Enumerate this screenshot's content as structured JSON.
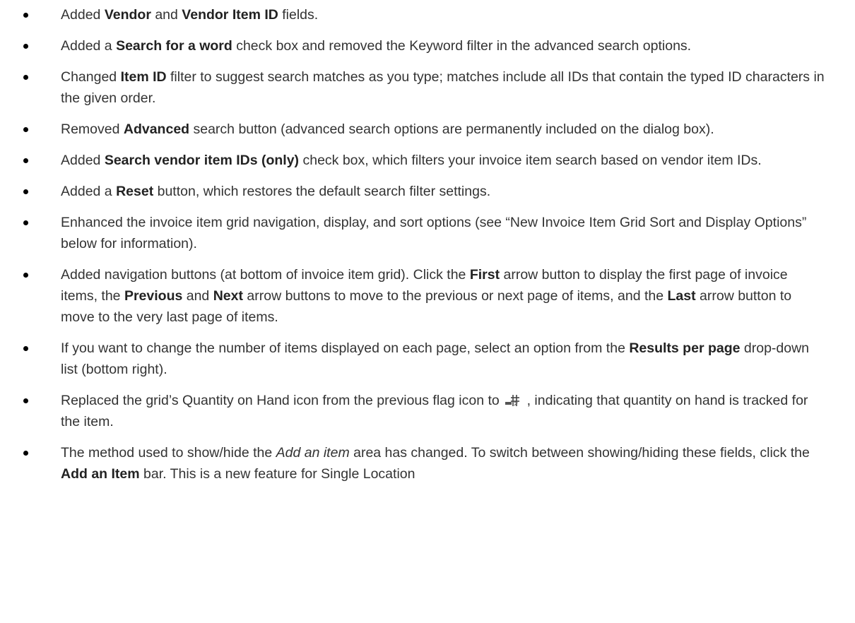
{
  "bullets": [
    {
      "segments": [
        {
          "t": "Added "
        },
        {
          "t": "Vendor",
          "b": true
        },
        {
          "t": " and "
        },
        {
          "t": "Vendor Item ID",
          "b": true
        },
        {
          "t": " fields."
        }
      ]
    },
    {
      "segments": [
        {
          "t": "Added a "
        },
        {
          "t": "Search for a word",
          "b": true
        },
        {
          "t": " check box and removed the Keyword filter in the advanced search options."
        }
      ]
    },
    {
      "segments": [
        {
          "t": "Changed "
        },
        {
          "t": "Item ID",
          "b": true
        },
        {
          "t": " filter to suggest search matches as you type; matches include all IDs that contain the typed ID characters in the given order."
        }
      ]
    },
    {
      "segments": [
        {
          "t": "Removed "
        },
        {
          "t": "Advanced",
          "b": true
        },
        {
          "t": " search button (advanced search options are permanently included on the dialog box)."
        }
      ]
    },
    {
      "segments": [
        {
          "t": "Added "
        },
        {
          "t": "Search vendor item IDs (only)",
          "b": true
        },
        {
          "t": " check box, which filters your invoice item search based on vendor item IDs."
        }
      ]
    },
    {
      "segments": [
        {
          "t": "Added a "
        },
        {
          "t": "Reset",
          "b": true
        },
        {
          "t": " button, which restores the default search filter settings."
        }
      ]
    },
    {
      "segments": [
        {
          "t": "Enhanced the invoice item grid navigation, display, and sort options (see “New Invoice Item Grid Sort and Display Options” below for information)."
        }
      ]
    },
    {
      "segments": [
        {
          "t": "Added navigation buttons (at bottom of invoice item grid). Click the "
        },
        {
          "t": "First",
          "b": true
        },
        {
          "t": " arrow button to display the first page of invoice items, the "
        },
        {
          "t": "Previous",
          "b": true
        },
        {
          "t": " and "
        },
        {
          "t": "Next",
          "b": true
        },
        {
          "t": " arrow buttons to move to the previous or next page of items, and the "
        },
        {
          "t": "Last",
          "b": true
        },
        {
          "t": " arrow button to move to the very last page of items."
        }
      ]
    },
    {
      "segments": [
        {
          "t": "If you want to change the number of items displayed on each page, select an option from the "
        },
        {
          "t": "Results per page",
          "b": true
        },
        {
          "t": " drop-down list (bottom right)."
        }
      ]
    },
    {
      "segments": [
        {
          "t": "Replaced the grid’s Quantity on Hand icon from the previous flag icon to "
        },
        {
          "icon": "quantity-on-hand-icon"
        },
        {
          "t": ", indicating that quantity on hand is tracked for the item."
        }
      ]
    },
    {
      "segments": [
        {
          "t": "The method used to show/hide the "
        },
        {
          "t": "Add an item",
          "i": true
        },
        {
          "t": " area has changed. To switch between showing/hiding these fields, click the "
        },
        {
          "t": "Add an Item",
          "b": true
        },
        {
          "t": " bar. This is a new feature for Single Location"
        }
      ]
    }
  ]
}
